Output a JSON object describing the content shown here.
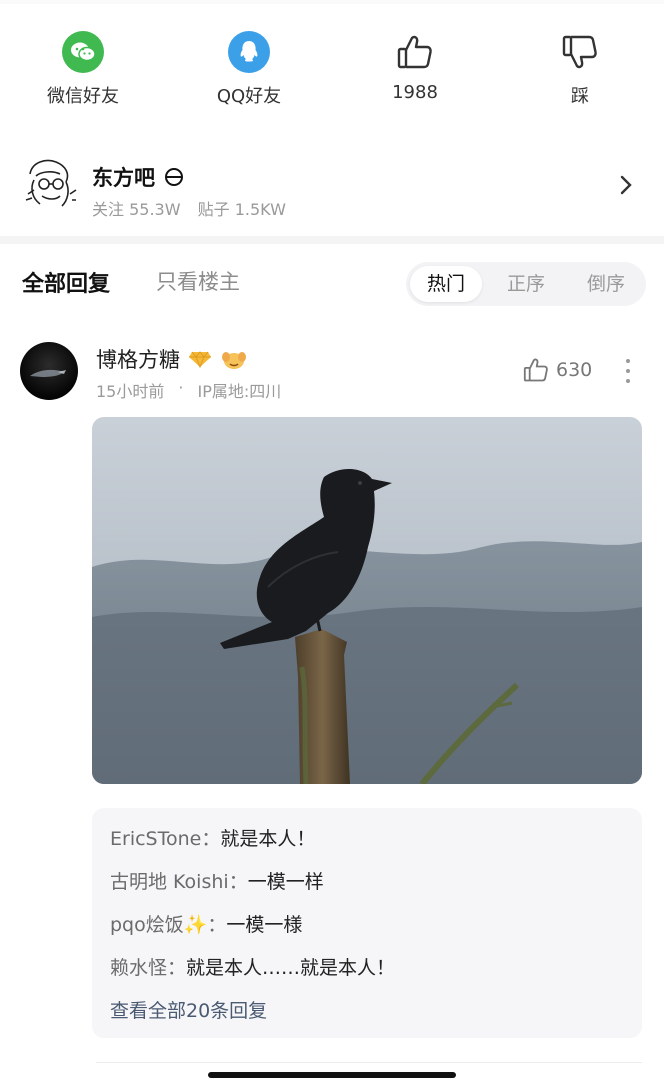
{
  "share": {
    "wechat_label": "微信好友",
    "qq_label": "QQ好友",
    "like_count": "1988",
    "dislike_label": "踩"
  },
  "forum": {
    "name": "东方吧",
    "followers": "关注 55.3W",
    "posts": "贴子 1.5KW"
  },
  "tabs": {
    "all_replies": "全部回复",
    "op_only": "只看楼主",
    "sort": [
      "热门",
      "正序",
      "倒序"
    ],
    "active_sort": "热门"
  },
  "post": {
    "username": "博格方糖",
    "time": "15小时前",
    "location": "IP属地:四川",
    "likes": "630"
  },
  "replies": [
    {
      "user": "EricSTone",
      "sep": "：",
      "text": "就是本人！"
    },
    {
      "user": "古明地 Koishi",
      "sep": "：",
      "text": "一模一样"
    },
    {
      "user": "pqo烩饭✨",
      "sep": "：",
      "text": "一模一様"
    },
    {
      "user": "赖水怪",
      "sep": "：",
      "text": "就是本人……就是本人！"
    }
  ],
  "view_all": "查看全部20条回复",
  "colors": {
    "wechat": "#3fb950",
    "qq": "#3ba0e8",
    "link": "#4a5a72"
  }
}
